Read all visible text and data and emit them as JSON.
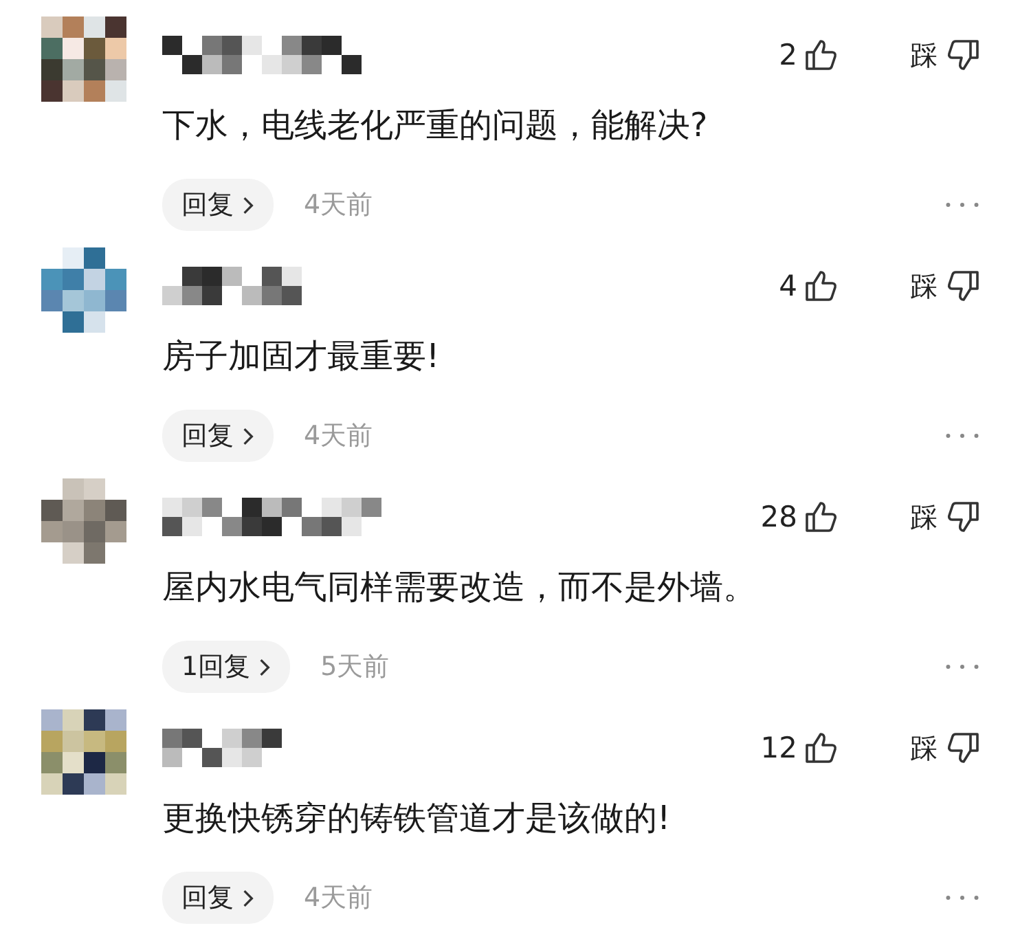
{
  "comments": [
    {
      "likes": "2",
      "dislike_label": "踩",
      "text": "下水，电线老化严重的问题，能解决?",
      "reply_button": "回复",
      "time": "4天前"
    },
    {
      "likes": "4",
      "dislike_label": "踩",
      "text": "房子加固才最重要!",
      "reply_button": "回复",
      "time": "4天前"
    },
    {
      "likes": "28",
      "dislike_label": "踩",
      "text": "屋内水电气同样需要改造，而不是外墙。",
      "reply_button": "1回复",
      "time": "5天前"
    },
    {
      "likes": "12",
      "dislike_label": "踩",
      "text": "更换快锈穿的铸铁管道才是该做的!",
      "reply_button": "回复",
      "time": "4天前"
    }
  ]
}
